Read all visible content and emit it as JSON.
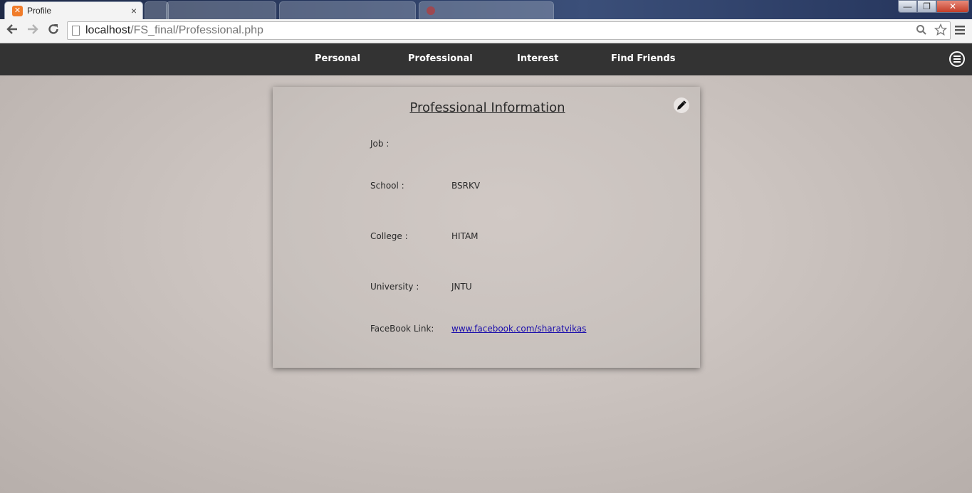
{
  "browser": {
    "tabs": [
      {
        "title": "Profile",
        "close": "×"
      },
      {
        "title": ""
      },
      {
        "title": ""
      },
      {
        "title": ""
      }
    ],
    "url_host": "localhost",
    "url_path": "/FS_final/Professional.php",
    "window_controls": {
      "minimize": "—",
      "maximize": "❐",
      "close": "✕"
    }
  },
  "nav": {
    "items": [
      "Personal",
      "Professional",
      "Interest",
      "Find Friends"
    ]
  },
  "card": {
    "title": "Professional Information",
    "fields": [
      {
        "label": "Job :",
        "value": ""
      },
      {
        "label": "School :",
        "value": "BSRKV"
      },
      {
        "label": "College :",
        "value": "HITAM"
      },
      {
        "label": "University :",
        "value": "JNTU"
      },
      {
        "label": "FaceBook Link:",
        "value": "www.facebook.com/sharatvikas"
      }
    ]
  },
  "icons": {
    "back": "arrow-left-icon",
    "forward": "arrow-right-icon",
    "reload": "reload-icon",
    "page": "page-icon",
    "search": "search-icon",
    "star": "star-icon",
    "menu": "menu-icon",
    "edit": "pencil-icon",
    "hamburger": "hamburger-icon"
  },
  "colors": {
    "navbar": "#333333",
    "link": "#1a0dab"
  }
}
